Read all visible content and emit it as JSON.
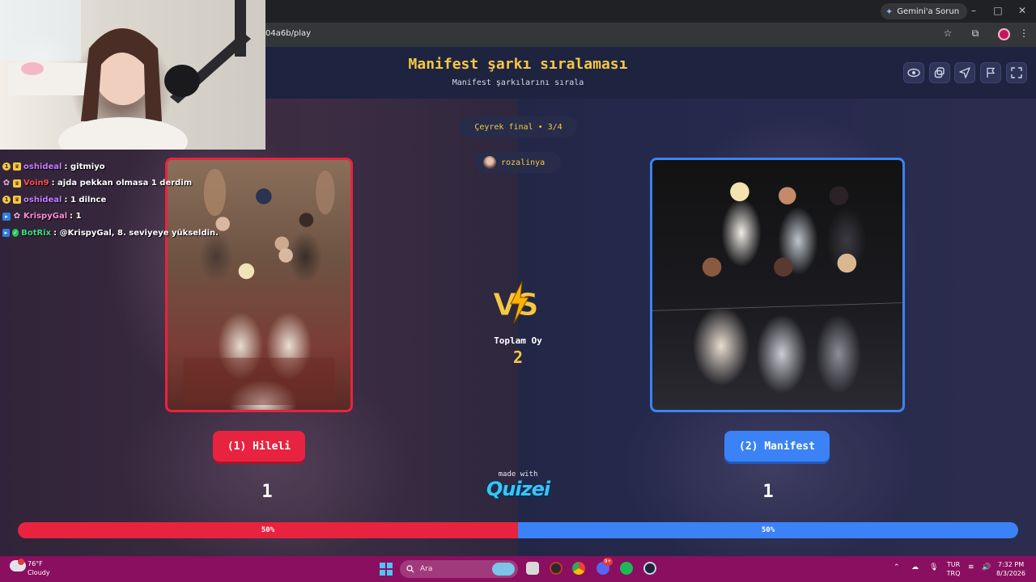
{
  "browser": {
    "gemini_button": "Gemini'a Sorun",
    "url": "04a6b/play"
  },
  "quiz": {
    "title": "Manifest şarkı sıralaması",
    "subtitle": "Manifest şarkılarını sırala",
    "round": "Çeyrek final • 3/4",
    "user": "rozalinya",
    "total_label": "Toplam Oy",
    "total_value": "2",
    "made_with": "made with",
    "logo": "Quizei",
    "left_option": "(1) Hileli",
    "right_option": "(2) Manifest",
    "left_votes": "1",
    "right_votes": "1",
    "left_percent_label": "50%",
    "right_percent_label": "50%",
    "left_share": 0.5,
    "colors": {
      "accent": "#f5c842",
      "left": "#e8233f",
      "right": "#3b82f6"
    }
  },
  "chat": [
    {
      "name": "oshideal",
      "name_color": "#c77dff",
      "message": ": gitmiyo",
      "badges": [
        "gold",
        "crown"
      ]
    },
    {
      "name": "Voin9",
      "name_color": "#ff4d4d",
      "message": ": ajda pekkan olmasa 1 derdim",
      "badges": [
        "pink",
        "crown"
      ]
    },
    {
      "name": "oshideal",
      "name_color": "#c77dff",
      "message": ": 1 dilnce",
      "badges": [
        "gold",
        "crown"
      ]
    },
    {
      "name": "KrispyGal",
      "name_color": "#ff8bd1",
      "message": ": 1",
      "badges": [
        "blue",
        "pink"
      ]
    },
    {
      "name": "BotRix",
      "name_color": "#3ddc84",
      "message": ": @KrispyGal, 8. seviyeye yükseldin.",
      "badges": [
        "blue",
        "green"
      ]
    }
  ],
  "taskbar": {
    "temp": "76°F",
    "condition": "Cloudy",
    "search_placeholder": "Ara",
    "lang_top": "TUR",
    "lang_bottom": "TRQ",
    "time": "7:32 PM",
    "date": "8/3/2026",
    "discord_badge": "9+"
  }
}
